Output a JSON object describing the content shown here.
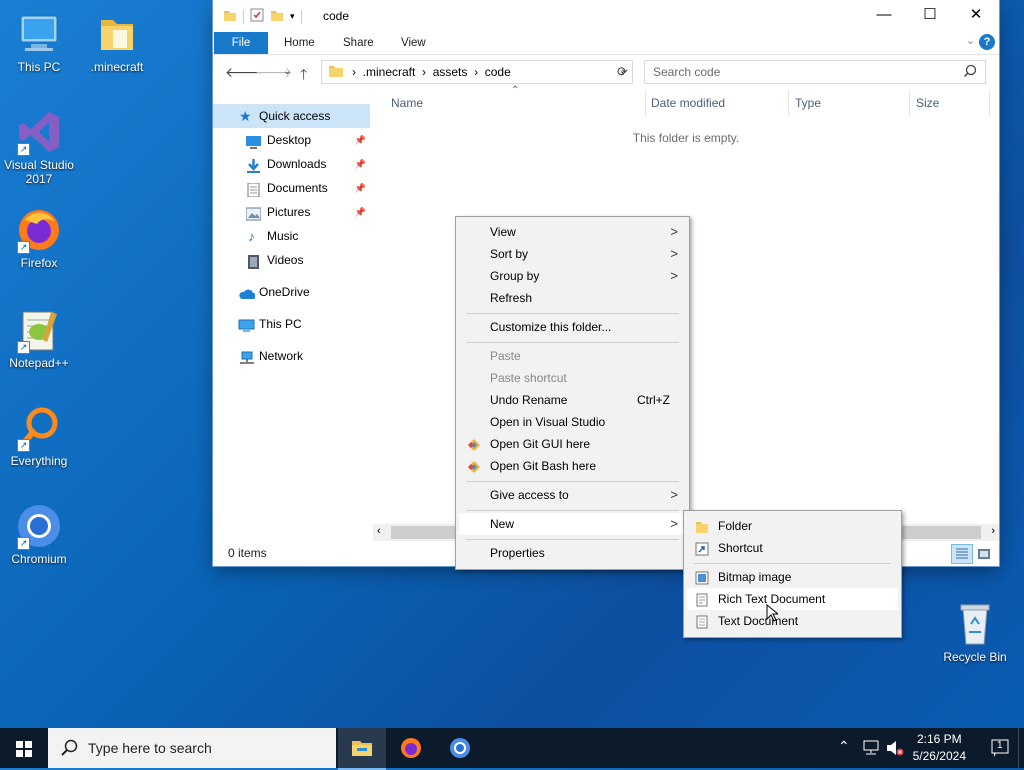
{
  "desktop": {
    "icons": [
      {
        "label": "This PC"
      },
      {
        "label": ".minecraft"
      },
      {
        "label": "Visual Studio 2017"
      },
      {
        "label": "Firefox"
      },
      {
        "label": "Notepad++"
      },
      {
        "label": "Everything"
      },
      {
        "label": "Chromium"
      },
      {
        "label": "Recycle Bin"
      }
    ]
  },
  "explorer": {
    "title": "code",
    "ribbon_tabs": [
      "File",
      "Home",
      "Share",
      "View"
    ],
    "breadcrumbs": [
      ".minecraft",
      "assets",
      "code"
    ],
    "search_placeholder": "Search code",
    "nav": {
      "quick_access": "Quick access",
      "pinned": [
        "Desktop",
        "Downloads",
        "Documents",
        "Pictures"
      ],
      "unpinned": [
        "Music",
        "Videos"
      ],
      "onedrive": "OneDrive",
      "this_pc": "This PC",
      "network": "Network"
    },
    "columns": [
      "Name",
      "Date modified",
      "Type",
      "Size"
    ],
    "empty_message": "This folder is empty.",
    "status": "0 items"
  },
  "context_menu": {
    "view": "View",
    "sort_by": "Sort by",
    "group_by": "Group by",
    "refresh": "Refresh",
    "customize": "Customize this folder...",
    "paste": "Paste",
    "paste_shortcut": "Paste shortcut",
    "undo_rename": "Undo Rename",
    "undo_shortcut": "Ctrl+Z",
    "open_vs": "Open in Visual Studio",
    "git_gui": "Open Git GUI here",
    "git_bash": "Open Git Bash here",
    "give_access": "Give access to",
    "new": "New",
    "properties": "Properties"
  },
  "new_submenu": {
    "folder": "Folder",
    "shortcut": "Shortcut",
    "bitmap": "Bitmap image",
    "rtf": "Rich Text Document",
    "txt": "Text Document"
  },
  "taskbar": {
    "search_placeholder": "Type here to search",
    "time": "2:16 PM",
    "date": "5/26/2024",
    "notification_count": "1"
  }
}
